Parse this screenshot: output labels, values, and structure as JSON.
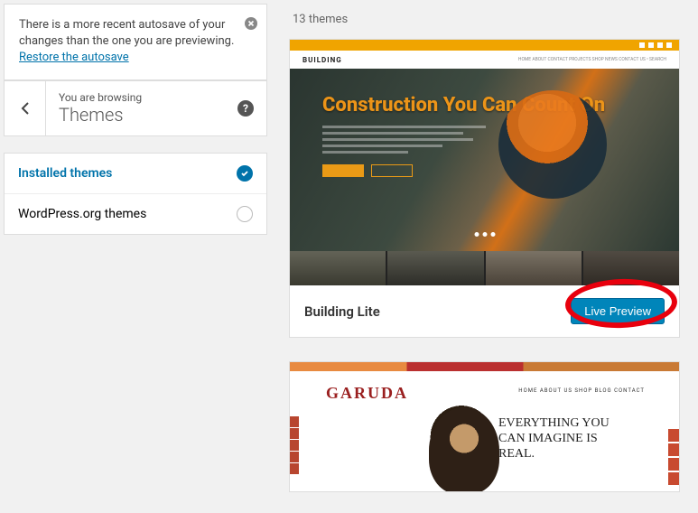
{
  "notice": {
    "text": "There is a more recent autosave of your changes than the one you are previewing.",
    "link": "Restore the autosave"
  },
  "header": {
    "browsing": "You are browsing",
    "title": "Themes"
  },
  "filters": {
    "installed": "Installed themes",
    "wporg": "WordPress.org themes"
  },
  "count_label": "13 themes",
  "themes": [
    {
      "name": "Building Lite",
      "button": "Live Preview",
      "logo": "BUILDING",
      "headline": "Construction You Can Count On",
      "nav": "HOME   ABOUT   CONTACT   PROJECTS   SHOP   NEWS   CONTACT US   •   SEARCH"
    },
    {
      "logo": "GARUDA",
      "menu": "HOME  ABOUT US  SHOP   BLOG  CONTACT",
      "headline": "EVERYTHING YOU CAN IMAGINE IS REAL."
    }
  ]
}
